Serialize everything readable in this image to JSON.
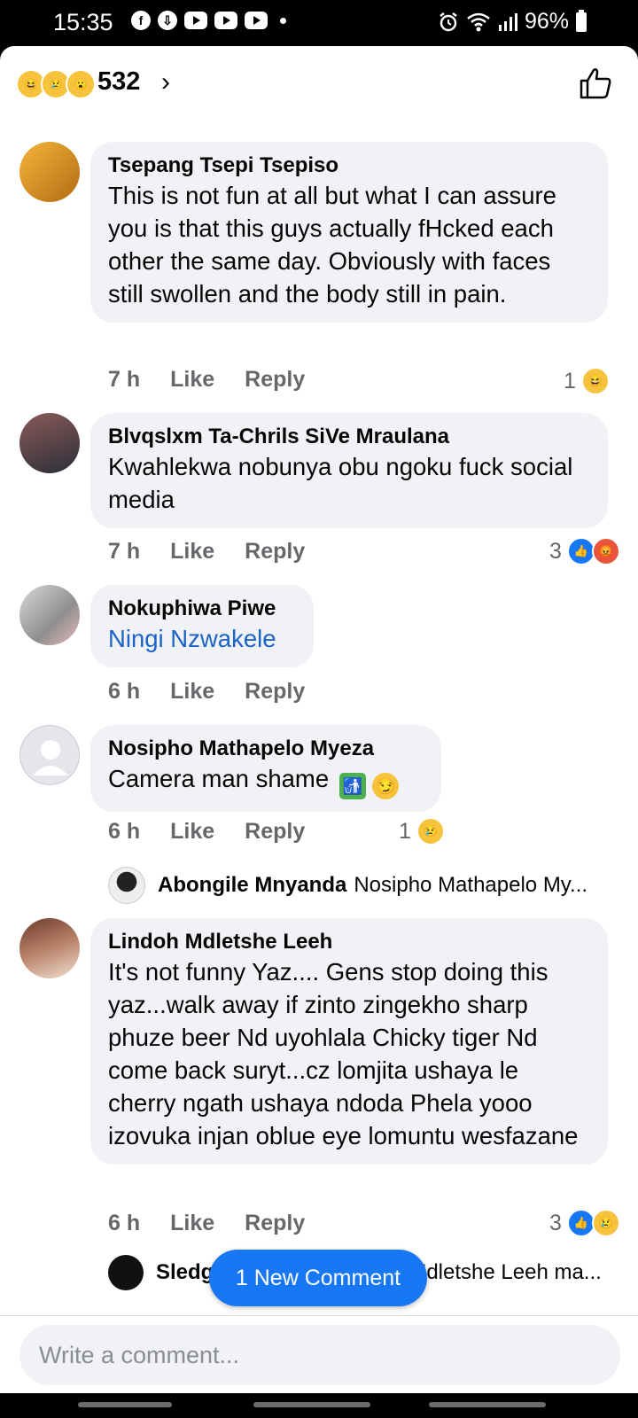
{
  "status_bar": {
    "time": "15:35",
    "battery": "96%",
    "facebook_icon": "f",
    "download_icon": "⇩"
  },
  "header": {
    "reaction_count": "532",
    "chevron": "›",
    "emojis": [
      "😆",
      "😢",
      "😮"
    ]
  },
  "comments": [
    {
      "author": "Tsepang Tsepi Tsepiso",
      "text": "This is not fun at all but what I can assure you is that this guys actually fHcked each other the same day. Obviously with faces still swollen and the body still in pain.",
      "time": "7 h",
      "like": "Like",
      "reply": "Reply",
      "reaction_count": "1"
    },
    {
      "author": "Blvqslxm Ta-Chrils SiVe Mraulana",
      "text": "Kwahlekwa nobunya obu ngoku fuck social media",
      "time": "7 h",
      "like": "Like",
      "reply": "Reply",
      "reaction_count": "3"
    },
    {
      "author": "Nokuphiwa Piwe",
      "text": "Ningi Nzwakele",
      "time": "6 h",
      "like": "Like",
      "reply": "Reply"
    },
    {
      "author": "Nosipho Mathapelo Myeza",
      "text": "Camera man shame",
      "time": "6 h",
      "like": "Like",
      "reply": "Reply",
      "reaction_count": "1",
      "reply_preview": {
        "author": "Abongile Mnyanda",
        "text": "Nosipho Mathapelo My..."
      }
    },
    {
      "author": "Lindoh Mdletshe Leeh",
      "text": "It's not funny Yaz.... Gens stop doing this yaz...walk away if zinto zingekho sharp phuze beer Nd uyohlala Chicky tiger Nd come back suryt...cz lomjita ushaya le cherry ngath ushaya ndoda Phela yooo izovuka injan oblue eye lomuntu wesfazane",
      "time": "6 h",
      "like": "Like",
      "reply": "Reply",
      "reaction_count": "3",
      "reply_preview": {
        "author": "Sledg",
        "text": "Mdletshe Leeh ma..."
      }
    }
  ],
  "new_comment_button": "1 New Comment",
  "compose": {
    "placeholder": "Write a comment..."
  },
  "colors": {
    "accent": "#1877f2",
    "bubble": "#f0f2f5",
    "meta_text": "#65676b"
  }
}
